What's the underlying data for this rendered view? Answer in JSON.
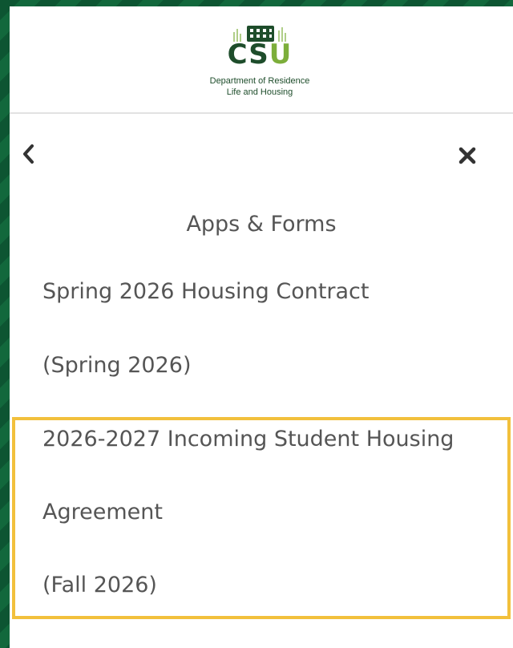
{
  "brand": {
    "logo_text_cs": "CS",
    "logo_text_u": "U",
    "department_line1": "Department of Residence",
    "department_line2": "Life and Housing",
    "logo_icon": "building-skyline-icon"
  },
  "nav": {
    "back_icon": "chevron-left-icon",
    "close_icon": "close-icon"
  },
  "menu": {
    "title": "Apps & Forms",
    "items": [
      {
        "lines": [
          "Spring 2026 Housing Contract",
          "(Spring 2026)"
        ]
      },
      {
        "lines": [
          "2026-2027 Incoming Student Housing",
          "Agreement",
          "(Fall 2026)"
        ],
        "highlighted": true
      }
    ]
  },
  "colors": {
    "brand_green": "#1e4d2b",
    "brand_light_green": "#7cae3a",
    "background_green": "#0e5a35",
    "highlight": "#f2c03c",
    "text": "#555555"
  }
}
